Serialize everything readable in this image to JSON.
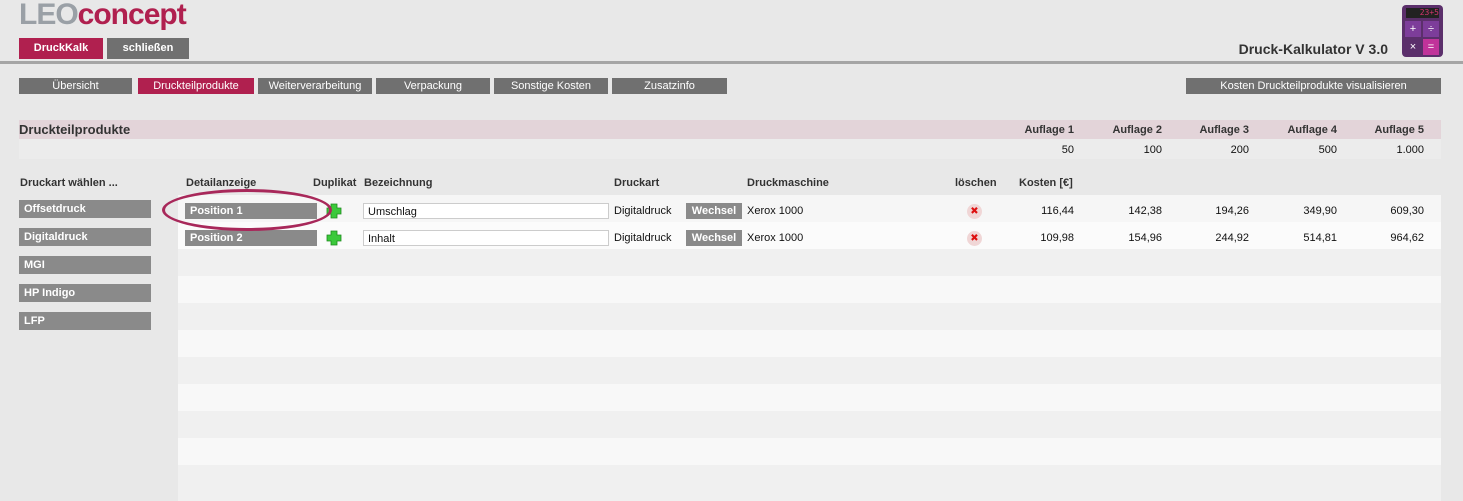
{
  "header": {
    "logo_leo": "LEO",
    "logo_concept": "concept",
    "druckkalk_label": "DruckKalk",
    "schliessen_label": "schließen",
    "app_title": "Druck-Kalkulator V 3.0",
    "calc_display": "23+5",
    "calc_keys": [
      "+",
      "÷",
      "×",
      "="
    ]
  },
  "tabs": [
    {
      "label": "Übersicht"
    },
    {
      "label": "Druckteilprodukte"
    },
    {
      "label": "Weiterverarbeitung"
    },
    {
      "label": "Verpackung"
    },
    {
      "label": "Sonstige Kosten"
    },
    {
      "label": "Zusatzinfo"
    }
  ],
  "visualize_label": "Kosten Druckteilprodukte visualisieren",
  "section": {
    "title": "Druckteilprodukte",
    "auflagen": [
      {
        "label": "Auflage 1",
        "value": "50"
      },
      {
        "label": "Auflage 2",
        "value": "100"
      },
      {
        "label": "Auflage 3",
        "value": "200"
      },
      {
        "label": "Auflage 4",
        "value": "500"
      },
      {
        "label": "Auflage 5",
        "value": "1.000"
      }
    ]
  },
  "left": {
    "header": "Druckart wählen ...",
    "items": [
      "Offsetdruck",
      "Digitaldruck",
      "MGI",
      "HP Indigo",
      "LFP"
    ]
  },
  "table": {
    "headers": {
      "detail": "Detailanzeige",
      "duplikat": "Duplikat",
      "bezeichnung": "Bezeichnung",
      "druckart": "Druckart",
      "druckmaschine": "Druckmaschine",
      "loeschen": "löschen",
      "kosten": "Kosten [€]"
    },
    "wechsel_label": "Wechsel",
    "rows": [
      {
        "position": "Position 1",
        "bezeichnung": "Umschlag",
        "druckart": "Digitaldruck",
        "maschine": "Xerox 1000",
        "costs": [
          "116,44",
          "142,38",
          "194,26",
          "349,90",
          "609,30"
        ]
      },
      {
        "position": "Position 2",
        "bezeichnung": "Inhalt",
        "druckart": "Digitaldruck",
        "maschine": "Xerox 1000",
        "costs": [
          "109,98",
          "154,96",
          "244,92",
          "514,81",
          "964,62"
        ]
      }
    ]
  },
  "colors": {
    "accent": "#b0204f",
    "gray_button": "#8a8a8a",
    "tab_gray": "#707070",
    "plus_green": "#3bc93b"
  }
}
